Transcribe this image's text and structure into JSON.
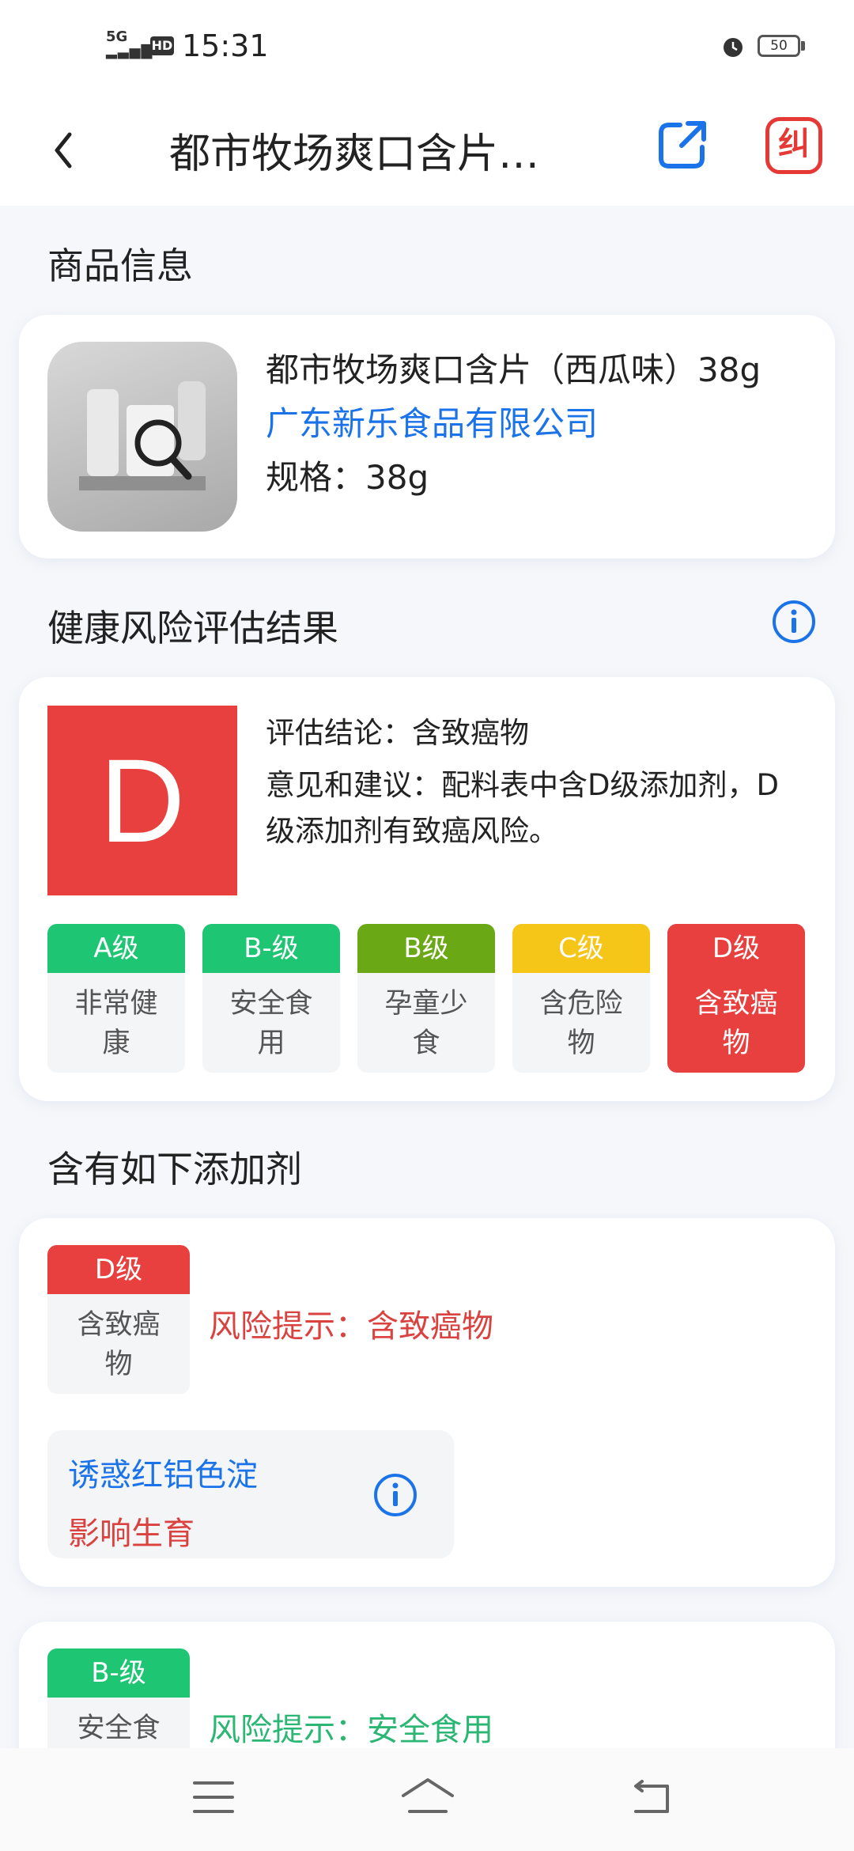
{
  "status_bar": {
    "signal_label": "5G",
    "hd_label": "HD",
    "time": "15:31",
    "battery": "50"
  },
  "header": {
    "title": "都市牧场爽口含片…",
    "correct_label": "纠"
  },
  "product_section": {
    "title": "商品信息",
    "name": "都市牧场爽口含片（西瓜味）38g",
    "company": "广东新乐食品有限公司",
    "spec": "规格：38g"
  },
  "assessment_section": {
    "title": "健康风险评估结果",
    "grade": "D",
    "conclusion": "评估结论：含致癌物",
    "advice": "意见和建议：配料表中含D级添加剂，D级添加剂有致癌风险。",
    "levels": [
      {
        "grade": "A级",
        "desc": "非常健康",
        "color": "#1ec573"
      },
      {
        "grade": "B-级",
        "desc": "安全食用",
        "color": "#1ec573"
      },
      {
        "grade": "B级",
        "desc": "孕童少食",
        "color": "#6aa816"
      },
      {
        "grade": "C级",
        "desc": "含危险物",
        "color": "#f5c518"
      },
      {
        "grade": "D级",
        "desc": "含致癌物",
        "color": "#e8403e"
      }
    ]
  },
  "additives_section": {
    "title": "含有如下添加剂",
    "items": [
      {
        "grade": "D级",
        "desc": "含致癌物",
        "color": "#e8403e",
        "risk": "风险提示：含致癌物",
        "ingredient": "诱惑红铝色淀",
        "effect": "影响生育"
      },
      {
        "grade": "B-级",
        "desc": "安全食",
        "color": "#1ec573",
        "risk": "风险提示：安全食用"
      }
    ]
  },
  "nav": {
    "icons": [
      "menu-icon",
      "home-icon",
      "back-icon"
    ]
  }
}
